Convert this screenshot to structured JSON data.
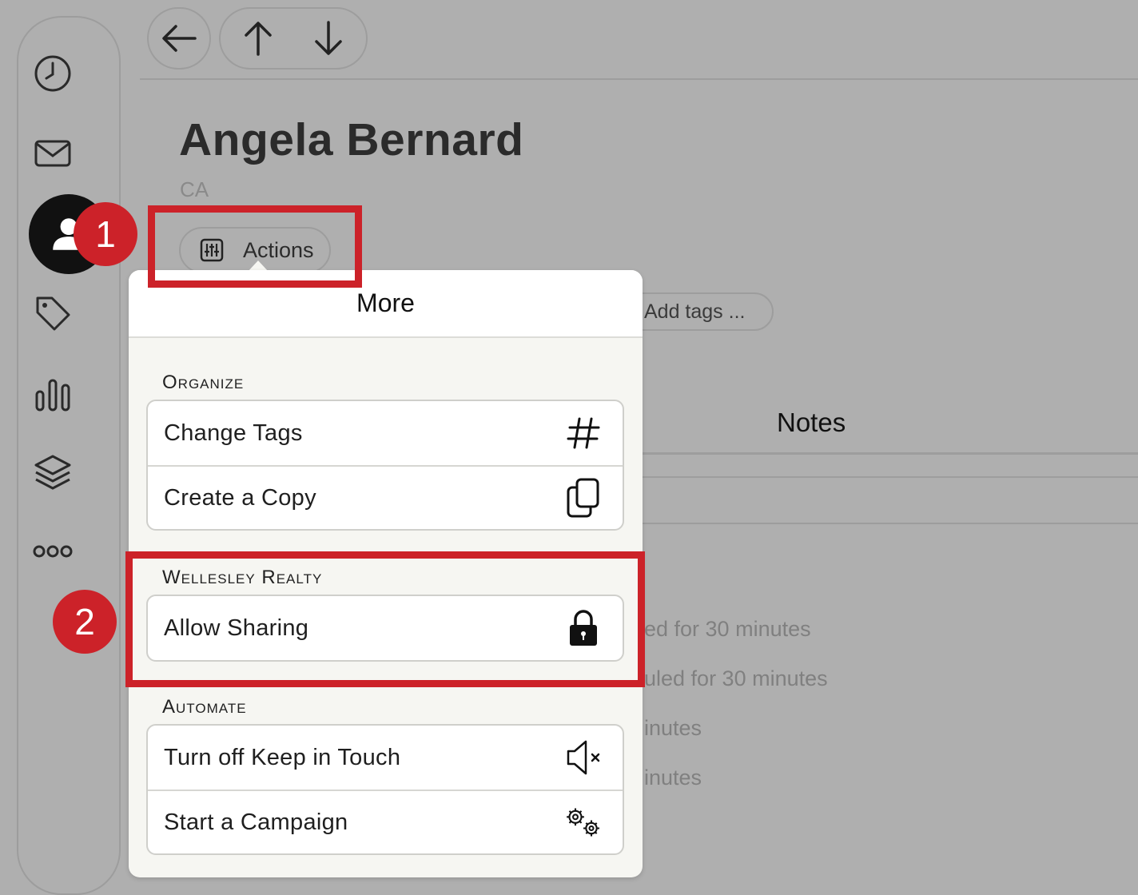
{
  "sidebar": {
    "items": [
      {
        "icon": "clock-icon"
      },
      {
        "icon": "mail-icon"
      },
      {
        "icon": "person-icon",
        "active": true
      },
      {
        "icon": "tag-icon"
      },
      {
        "icon": "bar-chart-icon"
      },
      {
        "icon": "layers-icon"
      },
      {
        "icon": "more-icon"
      }
    ]
  },
  "nav": {
    "back": "back-arrow-icon",
    "up": "up-arrow-icon",
    "down": "down-arrow-icon"
  },
  "contact": {
    "name": "Angela Bernard",
    "location": "CA"
  },
  "actions": {
    "label": "Actions"
  },
  "tags": {
    "placeholder": "Add tags ..."
  },
  "tabs": {
    "notes": "Notes"
  },
  "background_lines": [
    "ed for 30 minutes",
    "uled for 30 minutes",
    "inutes",
    "inutes"
  ],
  "popover": {
    "title": "More",
    "sections": [
      {
        "label": "Organize",
        "items": [
          {
            "label": "Change Tags",
            "icon": "hashtag-icon"
          },
          {
            "label": "Create a Copy",
            "icon": "copy-icon"
          }
        ]
      },
      {
        "label": "Wellesley Realty",
        "items": [
          {
            "label": "Allow Sharing",
            "icon": "lock-icon"
          }
        ]
      },
      {
        "label": "Automate",
        "items": [
          {
            "label": "Turn off Keep in Touch",
            "icon": "mute-speaker-icon"
          },
          {
            "label": "Start a Campaign",
            "icon": "gears-icon"
          }
        ]
      }
    ]
  },
  "annotations": {
    "badge1": "1",
    "badge2": "2",
    "highlight_color": "#cc2229"
  }
}
